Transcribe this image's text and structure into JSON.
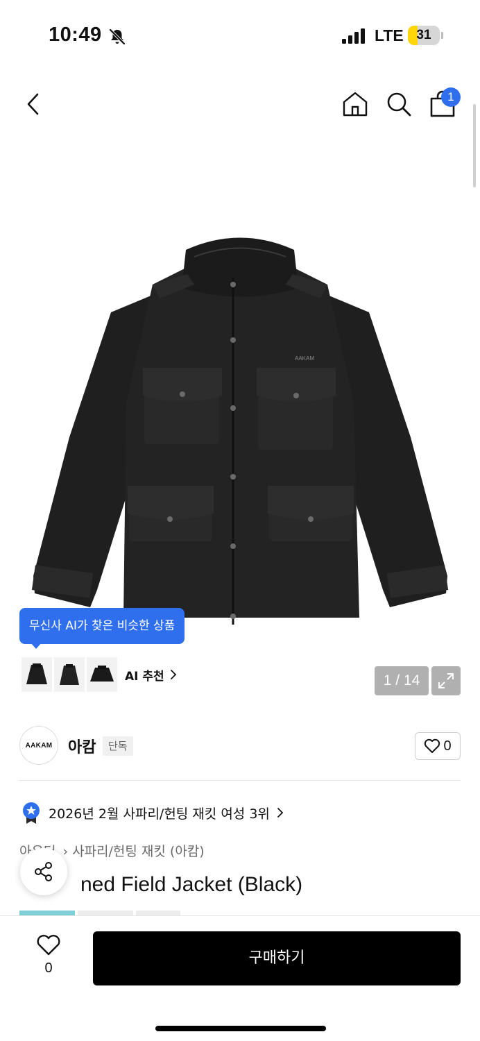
{
  "status_bar": {
    "time": "10:49",
    "network": "LTE",
    "battery_level": "31",
    "battery_fraction": 0.31,
    "icons": [
      "bell-slash-icon",
      "signal-icon",
      "battery-icon"
    ]
  },
  "nav": {
    "icons": [
      "back-arrow-icon",
      "home-icon",
      "search-icon",
      "shopping-bag-icon"
    ],
    "cart_count": "1"
  },
  "gallery": {
    "ai_tooltip": "무신사 AI가 찾은 비슷한 상품",
    "ai_recommend_label": "AI 추천",
    "counter": "1 / 14",
    "expand_icon": "expand-icon"
  },
  "brand": {
    "logo_text": "AAKAM",
    "name": "아캄",
    "tag": "단독",
    "like_count": "0"
  },
  "ranking": {
    "text": "2026년 2월 사파리/헌팅 재킷 여성 3위",
    "icon": "ranking-badge-icon"
  },
  "breadcrumb": {
    "partial": "아우터",
    "category": "사파리/헌팅 재킷 (아캄)"
  },
  "product": {
    "title_visible": "ned Field Jacket (Black)",
    "jacket_logo_text": "AAKAM"
  },
  "bottom_bar": {
    "like_count": "0",
    "buy_label": "구매하기"
  },
  "colors": {
    "accent_blue": "#2f6fed",
    "battery_yellow": "#ffd60a",
    "buy_button": "#000000"
  }
}
